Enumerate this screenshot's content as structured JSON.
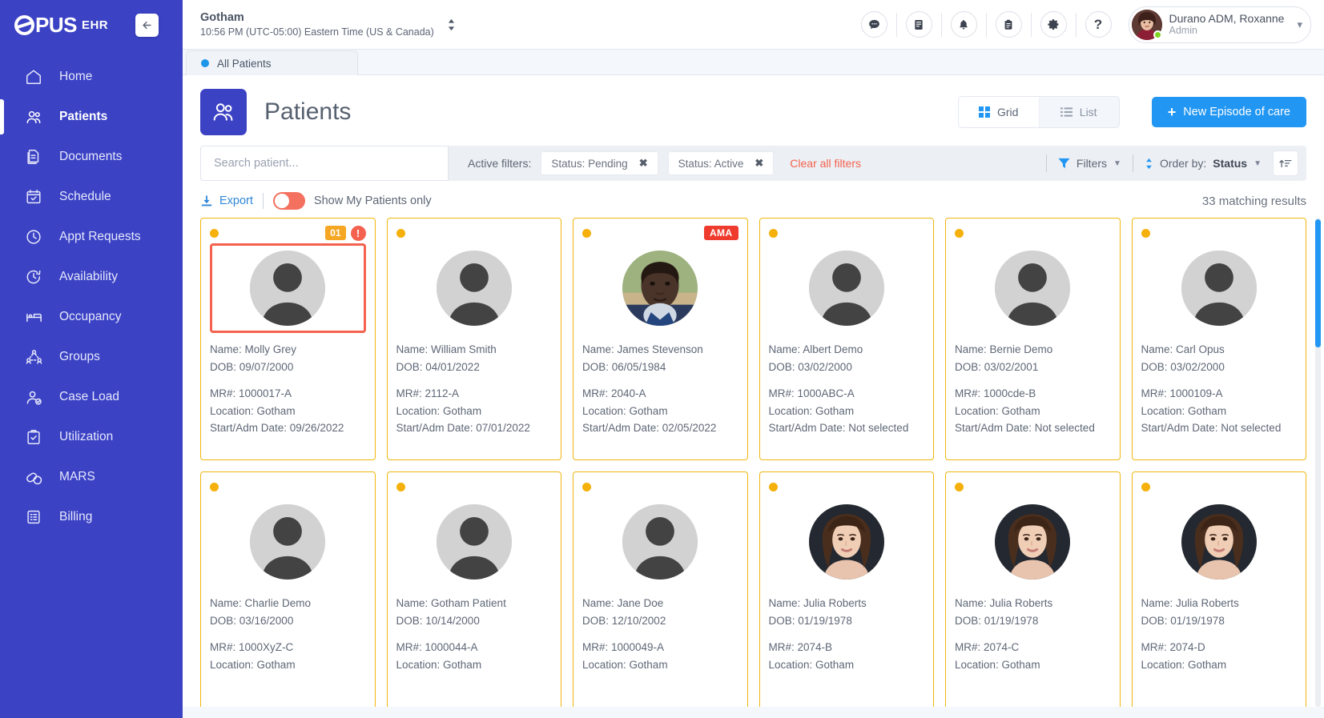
{
  "brand": {
    "logo_text": "PUS",
    "suffix": "EHR",
    "collapse_icon": "arrow-left-icon"
  },
  "sidebar": {
    "items": [
      {
        "label": "Home",
        "icon": "home-icon",
        "active": false
      },
      {
        "label": "Patients",
        "icon": "patients-icon",
        "active": true
      },
      {
        "label": "Documents",
        "icon": "documents-icon",
        "active": false
      },
      {
        "label": "Schedule",
        "icon": "calendar-icon",
        "active": false
      },
      {
        "label": "Appt Requests",
        "icon": "clock-icon",
        "active": false
      },
      {
        "label": "Availability",
        "icon": "clock-arrow-icon",
        "active": false
      },
      {
        "label": "Occupancy",
        "icon": "bed-icon",
        "active": false
      },
      {
        "label": "Groups",
        "icon": "groups-icon",
        "active": false
      },
      {
        "label": "Case Load",
        "icon": "case-load-icon",
        "active": false
      },
      {
        "label": "Utilization",
        "icon": "clipboard-check-icon",
        "active": false
      },
      {
        "label": "MARS",
        "icon": "pills-icon",
        "active": false
      },
      {
        "label": "Billing",
        "icon": "billing-icon",
        "active": false
      }
    ]
  },
  "topbar": {
    "facility_name": "Gotham",
    "facility_time": "10:56 PM (UTC-05:00) Eastern Time (US & Canada)",
    "icons": [
      "chat-icon",
      "book-icon",
      "bell-icon",
      "clipboard-icon",
      "gear-icon",
      "help-icon"
    ],
    "user_name": "Durano ADM, Roxanne",
    "user_role": "Admin"
  },
  "tabs": [
    {
      "label": "All Patients",
      "active": true
    }
  ],
  "page": {
    "title": "Patients",
    "icon": "patients-icon",
    "view_toggle": [
      {
        "label": "Grid",
        "icon": "grid-icon",
        "active": true
      },
      {
        "label": "List",
        "icon": "list-icon",
        "active": false
      }
    ],
    "new_episode_label": "New Episode of care"
  },
  "filters": {
    "search_placeholder": "Search patient...",
    "active_filters_label": "Active filters:",
    "chips": [
      {
        "label": "Status: Pending"
      },
      {
        "label": "Status: Active"
      }
    ],
    "clear_all_label": "Clear all filters",
    "filters_label": "Filters",
    "order_by_label": "Order by:",
    "order_by_value": "Status",
    "sort_icon": "sort-icon"
  },
  "toolbar": {
    "export_label": "Export",
    "export_icon": "download-icon",
    "toggle_label": "Show My Patients only",
    "toggle_on": true,
    "results_label": "33 matching results"
  },
  "labels": {
    "name_prefix": "Name: ",
    "dob_prefix": "DOB: ",
    "mr_prefix": "MR#: ",
    "location_prefix": "Location: ",
    "start_prefix": "Start/Adm Date: "
  },
  "colors": {
    "brand_blue": "#3b42c4",
    "accent_blue": "#2196f3",
    "card_border_yellow": "#f0b70e",
    "status_dot_yellow": "#f5b10a",
    "alert_red": "#f4624f",
    "ama_red": "#ef3b2d",
    "toggle_red": "#f4705f"
  },
  "patients": [
    {
      "name": "Molly Grey",
      "dob": "09/07/2000",
      "mr": "1000017-A",
      "location": "Gotham",
      "start": "09/26/2022",
      "selected": true,
      "count_badge": "01",
      "alert": true,
      "ama": false,
      "photo": "silhouette"
    },
    {
      "name": "William Smith",
      "dob": "04/01/2022",
      "mr": "2112-A",
      "location": "Gotham",
      "start": "07/01/2022",
      "selected": false,
      "count_badge": null,
      "alert": false,
      "ama": false,
      "photo": "silhouette"
    },
    {
      "name": "James Stevenson",
      "dob": "06/05/1984",
      "mr": "2040-A",
      "location": "Gotham",
      "start": "02/05/2022",
      "selected": false,
      "count_badge": null,
      "alert": false,
      "ama": true,
      "ama_label": "AMA",
      "photo": "man"
    },
    {
      "name": "Albert Demo",
      "dob": "03/02/2000",
      "mr": "1000ABC-A",
      "location": "Gotham",
      "start": "Not selected",
      "selected": false,
      "count_badge": null,
      "alert": false,
      "ama": false,
      "photo": "silhouette"
    },
    {
      "name": "Bernie Demo",
      "dob": "03/02/2001",
      "mr": "1000cde-B",
      "location": "Gotham",
      "start": "Not selected",
      "selected": false,
      "count_badge": null,
      "alert": false,
      "ama": false,
      "photo": "silhouette"
    },
    {
      "name": "Carl Opus",
      "dob": "03/02/2000",
      "mr": "1000109-A",
      "location": "Gotham",
      "start": "Not selected",
      "selected": false,
      "count_badge": null,
      "alert": false,
      "ama": false,
      "photo": "silhouette"
    },
    {
      "name": "Charlie Demo",
      "dob": "03/16/2000",
      "mr": "1000XyZ-C",
      "location": "Gotham",
      "start": "",
      "selected": false,
      "count_badge": null,
      "alert": false,
      "ama": false,
      "photo": "silhouette"
    },
    {
      "name": "Gotham Patient",
      "dob": "10/14/2000",
      "mr": "1000044-A",
      "location": "Gotham",
      "start": "",
      "selected": false,
      "count_badge": null,
      "alert": false,
      "ama": false,
      "photo": "silhouette"
    },
    {
      "name": "Jane Doe",
      "dob": "12/10/2002",
      "mr": "1000049-A",
      "location": "Gotham",
      "start": "",
      "selected": false,
      "count_badge": null,
      "alert": false,
      "ama": false,
      "photo": "silhouette"
    },
    {
      "name": "Julia Roberts",
      "dob": "01/19/1978",
      "mr": "2074-B",
      "location": "Gotham",
      "start": "",
      "selected": false,
      "count_badge": null,
      "alert": false,
      "ama": false,
      "photo": "woman"
    },
    {
      "name": "Julia Roberts",
      "dob": "01/19/1978",
      "mr": "2074-C",
      "location": "Gotham",
      "start": "",
      "selected": false,
      "count_badge": null,
      "alert": false,
      "ama": false,
      "photo": "woman"
    },
    {
      "name": "Julia Roberts",
      "dob": "01/19/1978",
      "mr": "2074-D",
      "location": "Gotham",
      "start": "",
      "selected": false,
      "count_badge": null,
      "alert": false,
      "ama": false,
      "photo": "woman"
    }
  ]
}
